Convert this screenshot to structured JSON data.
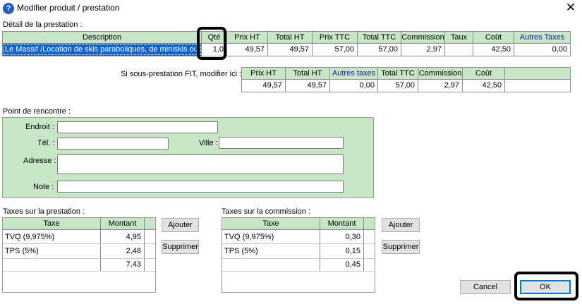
{
  "window": {
    "title": "Modifier produit / prestation",
    "help_glyph": "?",
    "close_glyph": "✕"
  },
  "detail": {
    "label": "Détail de la prestation :",
    "headers": [
      "Description",
      "Qté",
      "Prix HT",
      "Total HT",
      "Prix TTC",
      "Total TTC",
      "Commission",
      "Taux",
      "Coût",
      "Autres Taxes"
    ],
    "row": [
      "Le Massif /Location de skis paraboliques, de miniskis ou de planches",
      "1,0",
      "49,57",
      "49,57",
      "57,00",
      "57,00",
      "2,97",
      "",
      "42,50",
      "0,00"
    ]
  },
  "fit": {
    "label": "Si sous-prestation FIT, modifier ici :",
    "headers": [
      "Prix HT",
      "Total HT",
      "Autres taxes",
      "Total TTC",
      "Commission",
      "Coût"
    ],
    "row": [
      "49,57",
      "49,57",
      "0,00",
      "57,00",
      "2,97",
      "42,50"
    ]
  },
  "meeting": {
    "label": "Point de rencontre :",
    "endroit_label": "Endroit :",
    "tel_label": "Tél. :",
    "ville_label": "Ville :",
    "adresse_label": "Adresse :",
    "note_label": "Note :",
    "endroit_value": "",
    "tel_value": "",
    "ville_value": "",
    "adresse_value": "",
    "note_value": ""
  },
  "taxes_prestation": {
    "label": "Taxes sur la prestation :",
    "headers": [
      "Taxe",
      "Montant"
    ],
    "rows": [
      [
        "TVQ (9,975%)",
        "4,95"
      ],
      [
        "TPS (5%)",
        "2,48"
      ],
      [
        "",
        "7,43"
      ]
    ],
    "add_label": "Ajouter",
    "remove_label": "Supprimer"
  },
  "taxes_commission": {
    "label": "Taxes sur la commission :",
    "headers": [
      "Taxe",
      "Montant"
    ],
    "rows": [
      [
        "TVQ (9,975%)",
        "0,30"
      ],
      [
        "TPS (5%)",
        "0,15"
      ],
      [
        "",
        "0,45"
      ]
    ],
    "add_label": "Ajouter",
    "remove_label": "Supprimer"
  },
  "footer": {
    "cancel_label": "Cancel",
    "ok_label": "OK"
  },
  "colors": {
    "panel_green": "#c8e5c8",
    "selection_blue": "#0a64d0",
    "header_blue_text": "#1a1aa6"
  }
}
